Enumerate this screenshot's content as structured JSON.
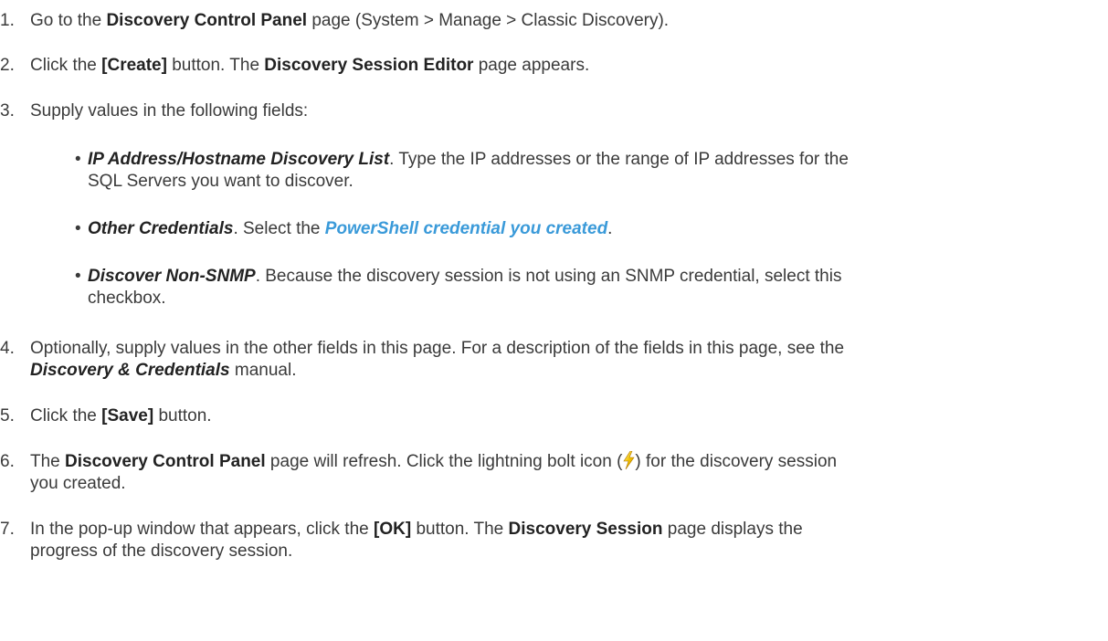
{
  "steps": [
    {
      "num": "1.",
      "parts": [
        {
          "t": "text",
          "v": "Go to the "
        },
        {
          "t": "bold",
          "v": "Discovery Control Panel"
        },
        {
          "t": "text",
          "v": " page (System > Manage > Classic Discovery)."
        }
      ]
    },
    {
      "num": "2.",
      "parts": [
        {
          "t": "text",
          "v": "Click the "
        },
        {
          "t": "bold",
          "v": "[Create]"
        },
        {
          "t": "text",
          "v": " button. The "
        },
        {
          "t": "bold",
          "v": "Discovery Session Editor"
        },
        {
          "t": "text",
          "v": " page appears."
        }
      ]
    },
    {
      "num": "3.",
      "parts": [
        {
          "t": "text",
          "v": "Supply values in the following fields:"
        }
      ]
    }
  ],
  "bullets": [
    {
      "field": "IP Address/Hostname Discovery List",
      "text": ". Type the IP addresses or the range of IP addresses for the",
      "text2": "SQL Servers you want to discover."
    },
    {
      "field": "Other Credentials",
      "text": ". Select the ",
      "link": "PowerShell credential you created",
      "text_after": "."
    },
    {
      "field": "Discover Non-SNMP",
      "text": ". Because the discovery session is not using an SNMP credential, select this",
      "text2": "checkbox."
    }
  ],
  "later_steps": {
    "s4": {
      "num": "4.",
      "line1": "Optionally, supply values in the other fields in this page. For a description of the fields in this page, see the",
      "manual": "Discovery & Credentials",
      "line2_after": " manual."
    },
    "s5": {
      "num": "5.",
      "pre": "Click the ",
      "btn": "[Save]",
      "post": " button."
    },
    "s6": {
      "num": "6.",
      "pre": "The ",
      "bold": "Discovery Control Panel",
      "mid": " page will refresh. Click the lightning bolt icon (",
      "post": ") for the discovery session",
      "line2": "you created."
    },
    "s7": {
      "num": "7.",
      "pre": "In the pop-up window that appears, click the ",
      "btn": "[OK]",
      "mid": " button. The ",
      "bold": "Discovery Session",
      "post": " page displays the",
      "line2": "progress of the discovery session."
    }
  },
  "icons": {
    "bolt": "lightning-bolt-icon"
  },
  "colors": {
    "text": "#3a3a3a",
    "link": "#3a9ad9",
    "bolt_yellow": "#f2c200"
  }
}
